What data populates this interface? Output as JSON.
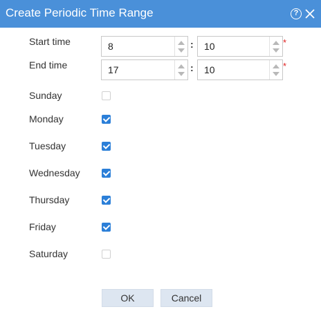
{
  "dialog": {
    "title": "Create Periodic Time Range",
    "help_glyph": "?"
  },
  "form": {
    "start_time": {
      "label": "Start time",
      "hour": "8",
      "minute": "10",
      "separator": ":",
      "required": "*"
    },
    "end_time": {
      "label": "End time",
      "hour": "17",
      "minute": "10",
      "separator": ":",
      "required": "*"
    }
  },
  "days": [
    {
      "label": "Sunday",
      "checked": false
    },
    {
      "label": "Monday",
      "checked": true
    },
    {
      "label": "Tuesday",
      "checked": true
    },
    {
      "label": "Wednesday",
      "checked": true
    },
    {
      "label": "Thursday",
      "checked": true
    },
    {
      "label": "Friday",
      "checked": true
    },
    {
      "label": "Saturday",
      "checked": false
    }
  ],
  "buttons": {
    "ok": "OK",
    "cancel": "Cancel"
  },
  "colors": {
    "titlebar": "#4a90d9",
    "checkbox_on": "#2b7fd8",
    "required": "#e02020",
    "button_bg": "#dde6f1"
  }
}
